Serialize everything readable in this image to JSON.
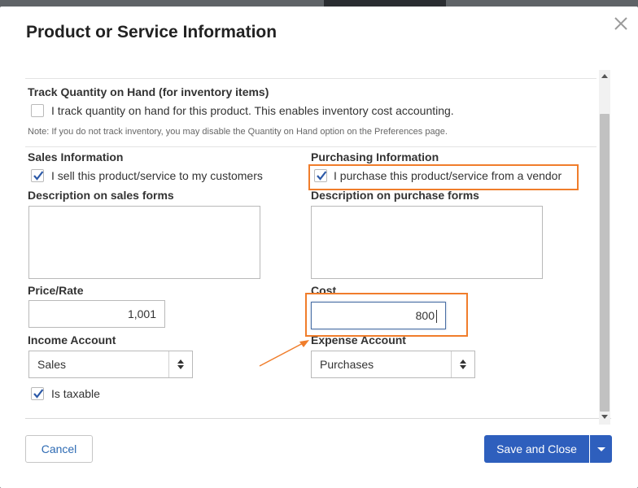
{
  "dialog": {
    "title": "Product or Service Information",
    "close_icon": "close-icon"
  },
  "inventory": {
    "heading": "Track Quantity on Hand (for inventory items)",
    "checkbox_label": "I track quantity on hand for this product. This enables inventory cost accounting.",
    "checked": false,
    "note": "Note: If you do not track inventory, you may disable the Quantity on Hand option on the Preferences page."
  },
  "sales": {
    "heading": "Sales Information",
    "checkbox_label": "I sell this product/service to my customers",
    "checked": true,
    "description_label": "Description on sales forms",
    "description_value": "",
    "price_label": "Price/Rate",
    "price_value": "1,001",
    "income_account_label": "Income Account",
    "income_account_value": "Sales",
    "taxable_label": "Is taxable",
    "taxable_checked": true
  },
  "purchasing": {
    "heading": "Purchasing Information",
    "checkbox_label": "I purchase this product/service from a vendor",
    "checked": true,
    "description_label": "Description on purchase forms",
    "description_value": "",
    "cost_label": "Cost",
    "cost_value": "800",
    "expense_account_label": "Expense Account",
    "expense_account_value": "Purchases"
  },
  "footer": {
    "cancel_label": "Cancel",
    "save_label": "Save and Close"
  },
  "colors": {
    "accent": "#2e5fbd",
    "highlight": "#f07d2b",
    "checkmark": "#2d5aa8"
  }
}
